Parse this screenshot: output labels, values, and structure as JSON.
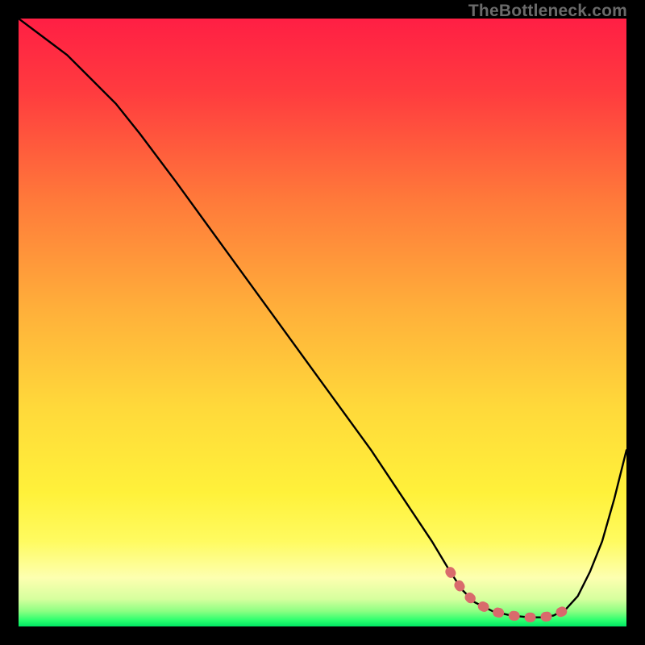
{
  "watermark": "TheBottleneck.com",
  "chart_data": {
    "type": "line",
    "title": "",
    "xlabel": "",
    "ylabel": "",
    "xlim": [
      0,
      100
    ],
    "ylim": [
      0,
      100
    ],
    "gradient_stops": [
      {
        "offset": 0.0,
        "color": "#ff1f44"
      },
      {
        "offset": 0.12,
        "color": "#ff3b3f"
      },
      {
        "offset": 0.3,
        "color": "#ff7a3a"
      },
      {
        "offset": 0.48,
        "color": "#ffb03a"
      },
      {
        "offset": 0.64,
        "color": "#ffd93a"
      },
      {
        "offset": 0.78,
        "color": "#fff13a"
      },
      {
        "offset": 0.86,
        "color": "#fffb60"
      },
      {
        "offset": 0.92,
        "color": "#fdffb0"
      },
      {
        "offset": 0.955,
        "color": "#d6ff9e"
      },
      {
        "offset": 0.975,
        "color": "#8cff82"
      },
      {
        "offset": 0.99,
        "color": "#2aff6e"
      },
      {
        "offset": 1.0,
        "color": "#00e663"
      }
    ],
    "series": [
      {
        "name": "bottleneck-curve",
        "x": [
          0,
          4,
          8,
          12,
          16,
          20,
          26,
          34,
          42,
          50,
          58,
          64,
          68,
          71,
          73,
          75,
          78,
          81,
          84,
          86,
          88,
          90,
          92,
          94,
          96,
          98,
          100
        ],
        "y": [
          100,
          97,
          94,
          90,
          86,
          81,
          73,
          62,
          51,
          40,
          29,
          20,
          14,
          9,
          6,
          4,
          2.5,
          1.8,
          1.5,
          1.5,
          1.8,
          2.8,
          5,
          9,
          14,
          21,
          29
        ]
      }
    ],
    "highlight": {
      "name": "optimal-zone",
      "color": "#d96a6c",
      "x": [
        71,
        73,
        75,
        78,
        81,
        84,
        86,
        88,
        89.5
      ],
      "y": [
        9,
        6,
        4,
        2.5,
        1.8,
        1.5,
        1.5,
        1.8,
        2.5
      ]
    }
  }
}
